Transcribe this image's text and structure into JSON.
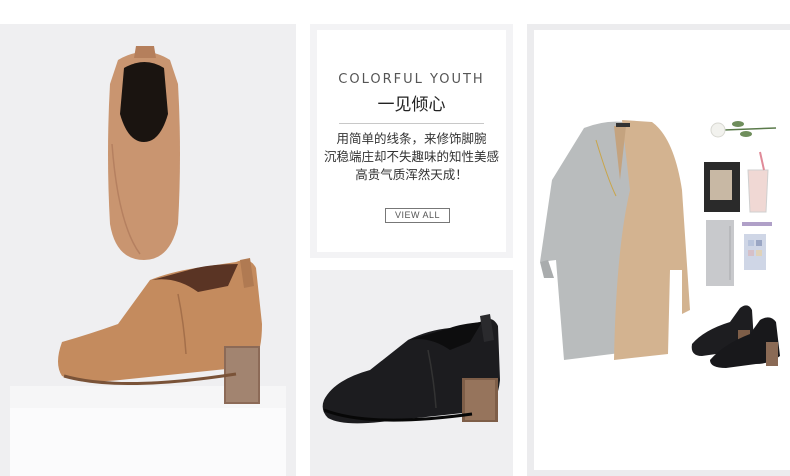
{
  "promo": {
    "title_en": "COLORFUL YOUTH",
    "title_cn": "一见倾心",
    "body_lines": [
      "用简单的线条，来修饰脚腕",
      "沉稳端庄却不失趣味的知性美感",
      "高贵气质浑然天成！"
    ],
    "view_all_label": "VIEW ALL"
  },
  "colors": {
    "tan_leather": "#c8926a",
    "black_leather": "#1e1e20",
    "heel_wood": "#8a6a55"
  },
  "icons": [
    "tan-bootie-image",
    "black-bootie-image",
    "outfit-flatlay-image"
  ]
}
